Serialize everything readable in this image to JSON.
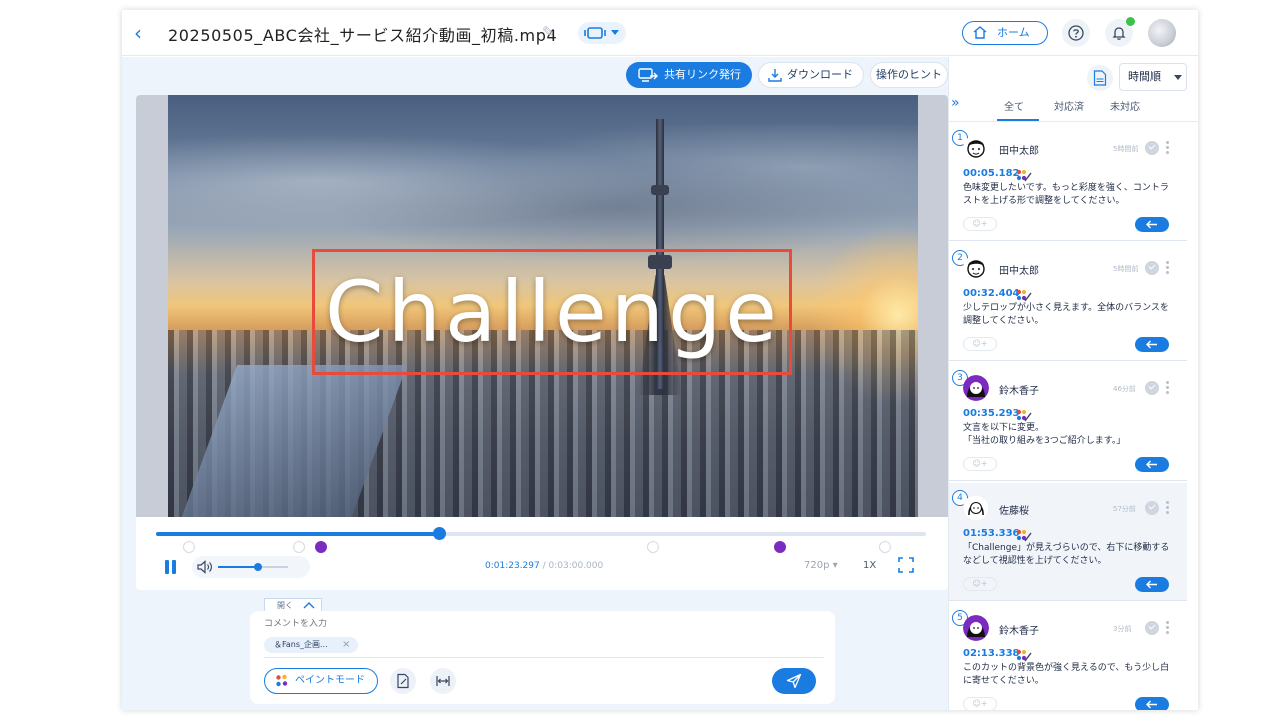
{
  "header": {
    "file_name": "20250505_ABC会社_サービス紹介動画_初稿.mp4",
    "home_label": "ホーム"
  },
  "toolbar": {
    "share_label": "共有リンク発行",
    "download_label": "ダウンロード",
    "hint_label": "操作のヒント"
  },
  "video": {
    "overlay_text": "Challenge",
    "progress": 0.368,
    "current_time": "0:01:23.297",
    "separator": " / ",
    "duration": "0:03:00.000",
    "quality": "720p",
    "speed": "1X",
    "volume": 0.57
  },
  "composer": {
    "open_label": "開く",
    "placeholder": "コメントを入力",
    "tag_label": "＆Fans_企画...",
    "paint_mode_label": "ペイントモード"
  },
  "side_panel": {
    "sort_value": "時間順",
    "filter_tabs": [
      {
        "label": "全て",
        "active": true
      },
      {
        "label": "対応済",
        "active": false
      },
      {
        "label": "未対応",
        "active": false
      }
    ],
    "comments": [
      {
        "num": "1",
        "name": "田中太郎",
        "ago": "5時間前",
        "time": "00:05.182",
        "text": "色味変更したいです。もっと彩度を強く、コントラストを上げる形で調整をしてください。",
        "avatar": "man-icon",
        "react": "☺+"
      },
      {
        "num": "2",
        "name": "田中太郎",
        "ago": "5時間前",
        "time": "00:32.404",
        "text": "少しテロップが小さく見えます。全体のバランスを調整してください。",
        "avatar": "man-icon",
        "react": "☺+"
      },
      {
        "num": "3",
        "name": "鈴木香子",
        "ago": "46分前",
        "time": "00:35.293",
        "text": "文言を以下に変更。\n「当社の取り組みを3つご紹介します。」",
        "avatar": "woman-purple-icon",
        "react": "☺+"
      },
      {
        "num": "4",
        "name": "佐藤桜",
        "ago": "57分前",
        "time": "01:53.336",
        "text": "「Challenge」が見えづらいので、右下に移動するなどして視認性を上げてください。",
        "avatar": "woman-icon",
        "react": "☺+"
      },
      {
        "num": "5",
        "name": "鈴木香子",
        "ago": "3分前",
        "time": "02:13.338",
        "text": "このカットの背景色が強く見えるので、もう少し白に寄せてください。",
        "avatar": "woman-purple-icon",
        "react": "☺+"
      }
    ]
  },
  "colors": {
    "accent": "#1a7ce0",
    "annotation": "#e84a3b",
    "avatar_purple": "#7b2cbf",
    "online": "#3bc24a"
  }
}
